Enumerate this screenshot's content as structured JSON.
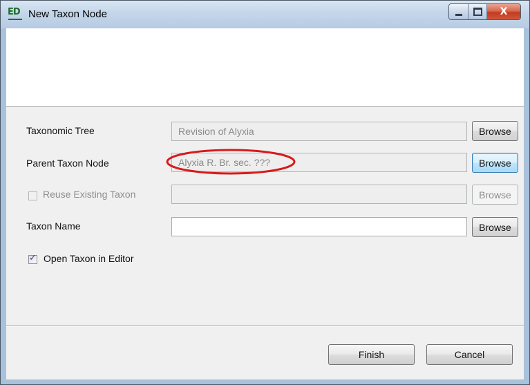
{
  "window": {
    "title": "New Taxon Node",
    "app_icon_text": "ED",
    "close_glyph": "X"
  },
  "form": {
    "taxonomic_tree": {
      "label": "Taxonomic Tree",
      "value": "Revision of Alyxia",
      "browse_label": "Browse"
    },
    "parent_taxon_node": {
      "label": "Parent Taxon Node",
      "value": "Alyxia R. Br. sec. ???",
      "browse_label": "Browse"
    },
    "reuse_existing_taxon": {
      "label": "Reuse Existing Taxon",
      "checked": false,
      "enabled": false,
      "value": "",
      "browse_label": "Browse"
    },
    "taxon_name": {
      "label": "Taxon Name",
      "value": "",
      "browse_label": "Browse"
    },
    "open_in_editor": {
      "label": "Open Taxon in Editor",
      "checked": true,
      "check_glyph": "✓"
    }
  },
  "footer": {
    "finish_label": "Finish",
    "cancel_label": "Cancel"
  },
  "annotation": {
    "color": "#d81a1a"
  }
}
